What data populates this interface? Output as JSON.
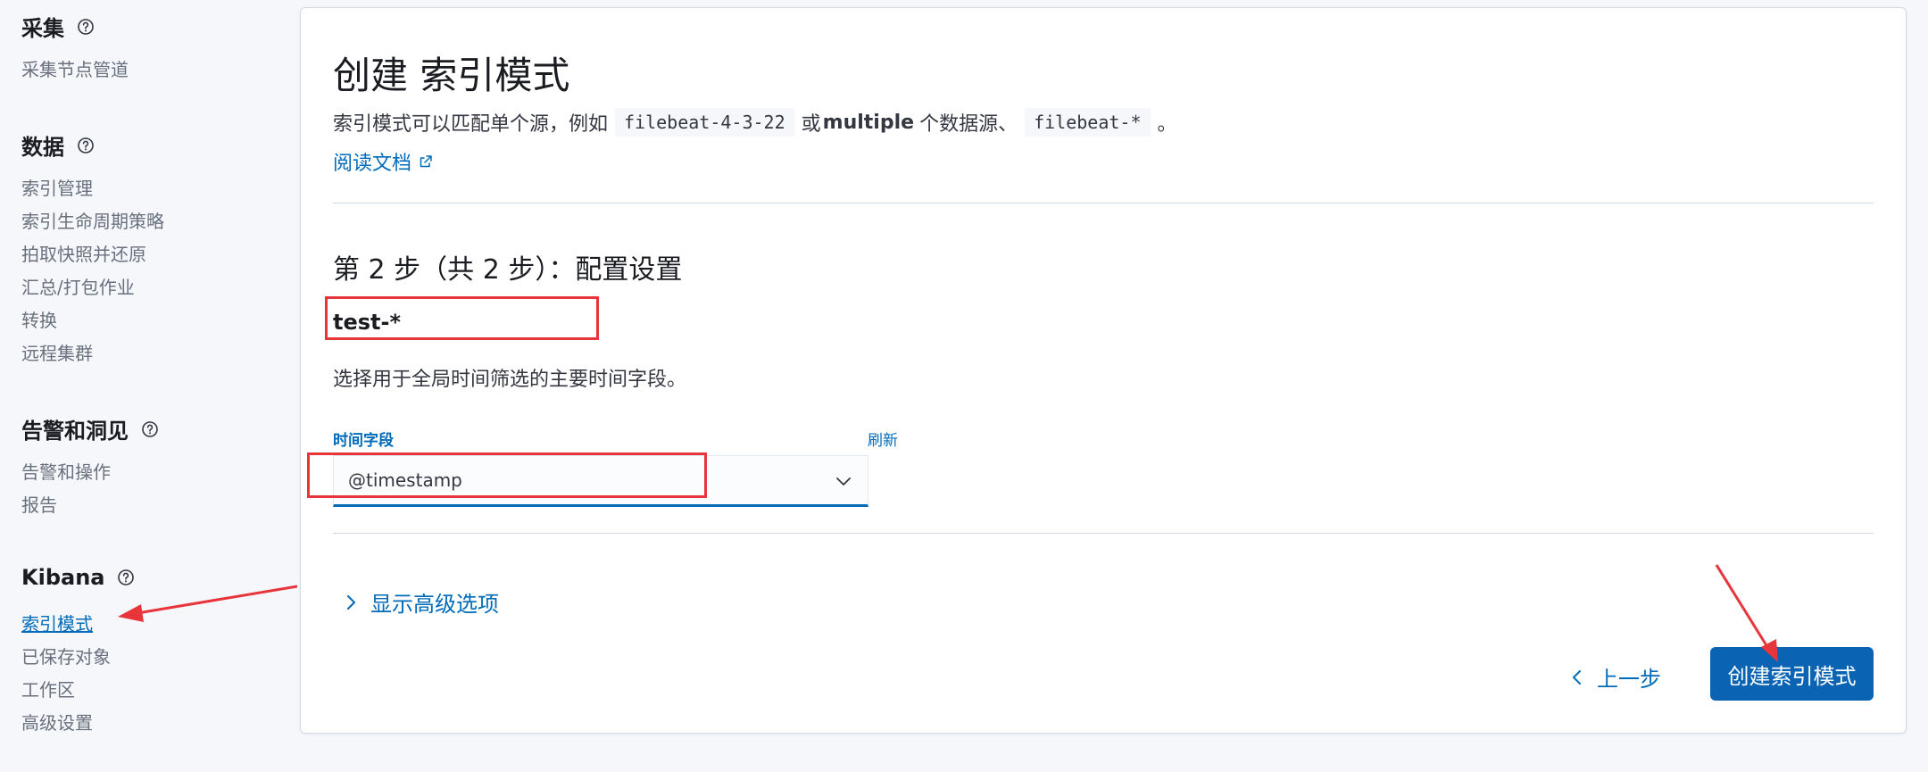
{
  "sidebar": {
    "sections": [
      {
        "title": "采集",
        "items": [
          "采集节点管道"
        ]
      },
      {
        "title": "数据",
        "items": [
          "索引管理",
          "索引生命周期策略",
          "拍取快照并还原",
          "汇总/打包作业",
          "转换",
          "远程集群"
        ]
      },
      {
        "title": "告警和洞见",
        "items": [
          "告警和操作",
          "报告"
        ]
      },
      {
        "title": "Kibana",
        "items": [
          "索引模式",
          "已保存对象",
          "工作区",
          "高级设置"
        ]
      }
    ]
  },
  "main": {
    "title": "创建 索引模式",
    "description": {
      "part1": "索引模式可以匹配单个源，例如",
      "code1": "filebeat-4-3-22",
      "part2": "或",
      "bold": "multiple",
      "part3": "个数据源、",
      "code2": "filebeat-*",
      "part4": "。"
    },
    "doc_link": "阅读文档",
    "step_title": "第 2 步（共 2 步）：配置设置",
    "pattern_name": "test-*",
    "time_field_hint": "选择用于全局时间筛选的主要时间字段。",
    "time_field": {
      "label": "时间字段",
      "refresh": "刷新",
      "value": "@timestamp"
    },
    "advanced_toggle": "显示高级选项",
    "back_button": "上一步",
    "create_button": "创建索引模式"
  },
  "colors": {
    "accent": "#006bb8",
    "primary_button": "#0b64b3",
    "annotation": "#e8353b"
  }
}
